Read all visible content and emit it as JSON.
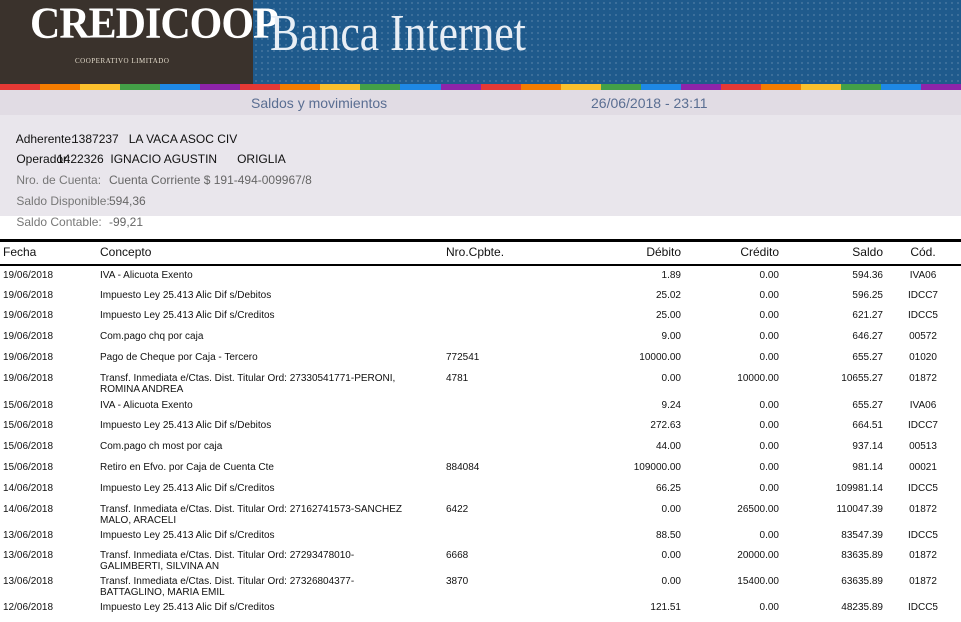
{
  "banner": {
    "brand": "CREDICOOP",
    "brand_sub": "COOPERATIVO LIMITADO",
    "title": "Banca Internet",
    "stripe_colors": [
      "#e53935",
      "#f57c00",
      "#fbc02d",
      "#43a047",
      "#1e88e5",
      "#8e24aa",
      "#e53935",
      "#f57c00",
      "#fbc02d",
      "#43a047",
      "#1e88e5",
      "#8e24aa",
      "#e53935",
      "#f57c00",
      "#fbc02d",
      "#43a047",
      "#1e88e5",
      "#8e24aa",
      "#e53935",
      "#f57c00",
      "#fbc02d",
      "#43a047",
      "#1e88e5",
      "#8e24aa"
    ]
  },
  "header": {
    "section_title": "Saldos y movimientos",
    "datetime": "26/06/2018 - 23:11"
  },
  "account": {
    "adherente_label": "Adherente:",
    "adherente_value": "1387237   LA VACA ASOC CIV",
    "operador_label": "Operador:",
    "operador_value": "1422326  IGNACIO AGUSTIN      ORIGLIA",
    "cuenta_label": "Nro. de Cuenta:",
    "cuenta_value": "Cuenta Corriente $ 191-494-009967/8",
    "disponible_label": "Saldo Disponible:",
    "disponible_value": "594,36",
    "contable_label": "Saldo Contable:",
    "contable_value": "-99,21"
  },
  "table": {
    "columns": [
      "Fecha",
      "Concepto",
      "Nro.Cpbte.",
      "Débito",
      "Crédito",
      "Saldo",
      "Cód."
    ],
    "rows": [
      {
        "fecha": "19/06/2018",
        "concepto": "IVA - Alicuota Exento",
        "concepto2": "",
        "cpbte": "",
        "debito": "1.89",
        "credito": "0.00",
        "saldo": "594.36",
        "cod": "IVA06"
      },
      {
        "fecha": "19/06/2018",
        "concepto": "Impuesto Ley 25.413 Alic Dif s/Debitos",
        "concepto2": "",
        "cpbte": "",
        "debito": "25.02",
        "credito": "0.00",
        "saldo": "596.25",
        "cod": "IDCC7"
      },
      {
        "fecha": "19/06/2018",
        "concepto": "Impuesto Ley 25.413 Alic Dif s/Creditos",
        "concepto2": "",
        "cpbte": "",
        "debito": "25.00",
        "credito": "0.00",
        "saldo": "621.27",
        "cod": "IDCC5"
      },
      {
        "fecha": "19/06/2018",
        "concepto": "Com.pago chq por caja",
        "concepto2": "",
        "cpbte": "",
        "debito": "9.00",
        "credito": "0.00",
        "saldo": "646.27",
        "cod": "00572"
      },
      {
        "fecha": "19/06/2018",
        "concepto": "Pago de Cheque por Caja - Tercero",
        "concepto2": "",
        "cpbte": "772541",
        "debito": "10000.00",
        "credito": "0.00",
        "saldo": "655.27",
        "cod": "01020"
      },
      {
        "fecha": "19/06/2018",
        "concepto": "Transf. Inmediata e/Ctas. Dist. Titular Ord: 27330541771-PERONI,",
        "concepto2": "ROMINA ANDREA",
        "cpbte": "4781",
        "debito": "0.00",
        "credito": "10000.00",
        "saldo": "10655.27",
        "cod": "01872"
      },
      {
        "fecha": "15/06/2018",
        "concepto": "IVA - Alicuota Exento",
        "concepto2": "",
        "cpbte": "",
        "debito": "9.24",
        "credito": "0.00",
        "saldo": "655.27",
        "cod": "IVA06"
      },
      {
        "fecha": "15/06/2018",
        "concepto": "Impuesto Ley 25.413 Alic Dif s/Debitos",
        "concepto2": "",
        "cpbte": "",
        "debito": "272.63",
        "credito": "0.00",
        "saldo": "664.51",
        "cod": "IDCC7"
      },
      {
        "fecha": "15/06/2018",
        "concepto": "Com.pago ch most por caja",
        "concepto2": "",
        "cpbte": "",
        "debito": "44.00",
        "credito": "0.00",
        "saldo": "937.14",
        "cod": "00513"
      },
      {
        "fecha": "15/06/2018",
        "concepto": "Retiro en Efvo. por Caja de Cuenta Cte",
        "concepto2": "",
        "cpbte": "884084",
        "debito": "109000.00",
        "credito": "0.00",
        "saldo": "981.14",
        "cod": "00021"
      },
      {
        "fecha": "14/06/2018",
        "concepto": "Impuesto Ley 25.413 Alic Dif s/Creditos",
        "concepto2": "",
        "cpbte": "",
        "debito": "66.25",
        "credito": "0.00",
        "saldo": "109981.14",
        "cod": "IDCC5"
      },
      {
        "fecha": "14/06/2018",
        "concepto": "Transf. Inmediata e/Ctas. Dist. Titular Ord: 27162741573-SANCHEZ",
        "concepto2": "MALO, ARACELI",
        "cpbte": "6422",
        "debito": "0.00",
        "credito": "26500.00",
        "saldo": "110047.39",
        "cod": "01872"
      },
      {
        "fecha": "13/06/2018",
        "concepto": "Impuesto Ley 25.413 Alic Dif s/Creditos",
        "concepto2": "",
        "cpbte": "",
        "debito": "88.50",
        "credito": "0.00",
        "saldo": "83547.39",
        "cod": "IDCC5"
      },
      {
        "fecha": "13/06/2018",
        "concepto": "Transf. Inmediata e/Ctas. Dist. Titular Ord: 27293478010-",
        "concepto2": "GALIMBERTI, SILVINA AN",
        "cpbte": "6668",
        "debito": "0.00",
        "credito": "20000.00",
        "saldo": "83635.89",
        "cod": "01872"
      },
      {
        "fecha": "13/06/2018",
        "concepto": "Transf. Inmediata e/Ctas. Dist. Titular Ord: 27326804377-",
        "concepto2": "BATTAGLINO, MARIA EMIL",
        "cpbte": "3870",
        "debito": "0.00",
        "credito": "15400.00",
        "saldo": "63635.89",
        "cod": "01872"
      },
      {
        "fecha": "12/06/2018",
        "concepto": "Impuesto Ley 25.413 Alic Dif s/Creditos",
        "concepto2": "",
        "cpbte": "",
        "debito": "121.51",
        "credito": "0.00",
        "saldo": "48235.89",
        "cod": "IDCC5"
      }
    ]
  }
}
